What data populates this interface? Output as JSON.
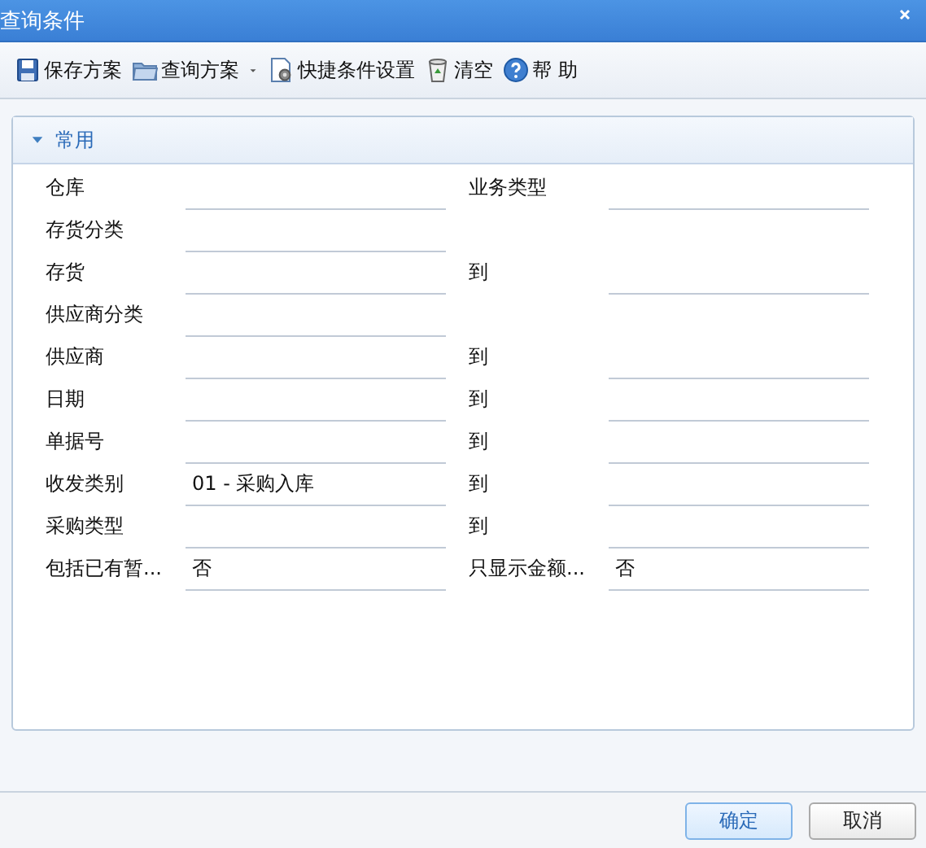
{
  "window": {
    "title": "查询条件"
  },
  "toolbar": [
    {
      "label": "保存方案",
      "dropdown": false
    },
    {
      "label": "查询方案",
      "dropdown": true
    },
    {
      "label": "快捷条件设置",
      "dropdown": false
    },
    {
      "label": "清空",
      "dropdown": false
    },
    {
      "label": "帮 助",
      "dropdown": false
    }
  ],
  "section": {
    "title": "常用",
    "expanded": true,
    "rows": [
      {
        "label": "仓库",
        "value": "",
        "right_label": "业务类型",
        "right_value": ""
      },
      {
        "label": "存货分类",
        "value": ""
      },
      {
        "label": "存货",
        "value": "",
        "right_label": "到",
        "right_value": ""
      },
      {
        "label": "供应商分类",
        "value": ""
      },
      {
        "label": "供应商",
        "value": "",
        "right_label": "到",
        "right_value": ""
      },
      {
        "label": "日期",
        "value": "",
        "right_label": "到",
        "right_value": ""
      },
      {
        "label": "单据号",
        "value": "",
        "right_label": "到",
        "right_value": ""
      },
      {
        "label": "收发类别",
        "value": "01 - 采购入库",
        "right_label": "到",
        "right_value": ""
      },
      {
        "label": "采购类型",
        "value": "",
        "right_label": "到",
        "right_value": ""
      },
      {
        "label": "包括已有暂...",
        "value": "否",
        "right_label": "只显示金额...",
        "right_value": "否"
      }
    ]
  },
  "buttons": [
    {
      "label": "确定",
      "focused": true
    },
    {
      "label": "取消",
      "focused": false
    }
  ]
}
